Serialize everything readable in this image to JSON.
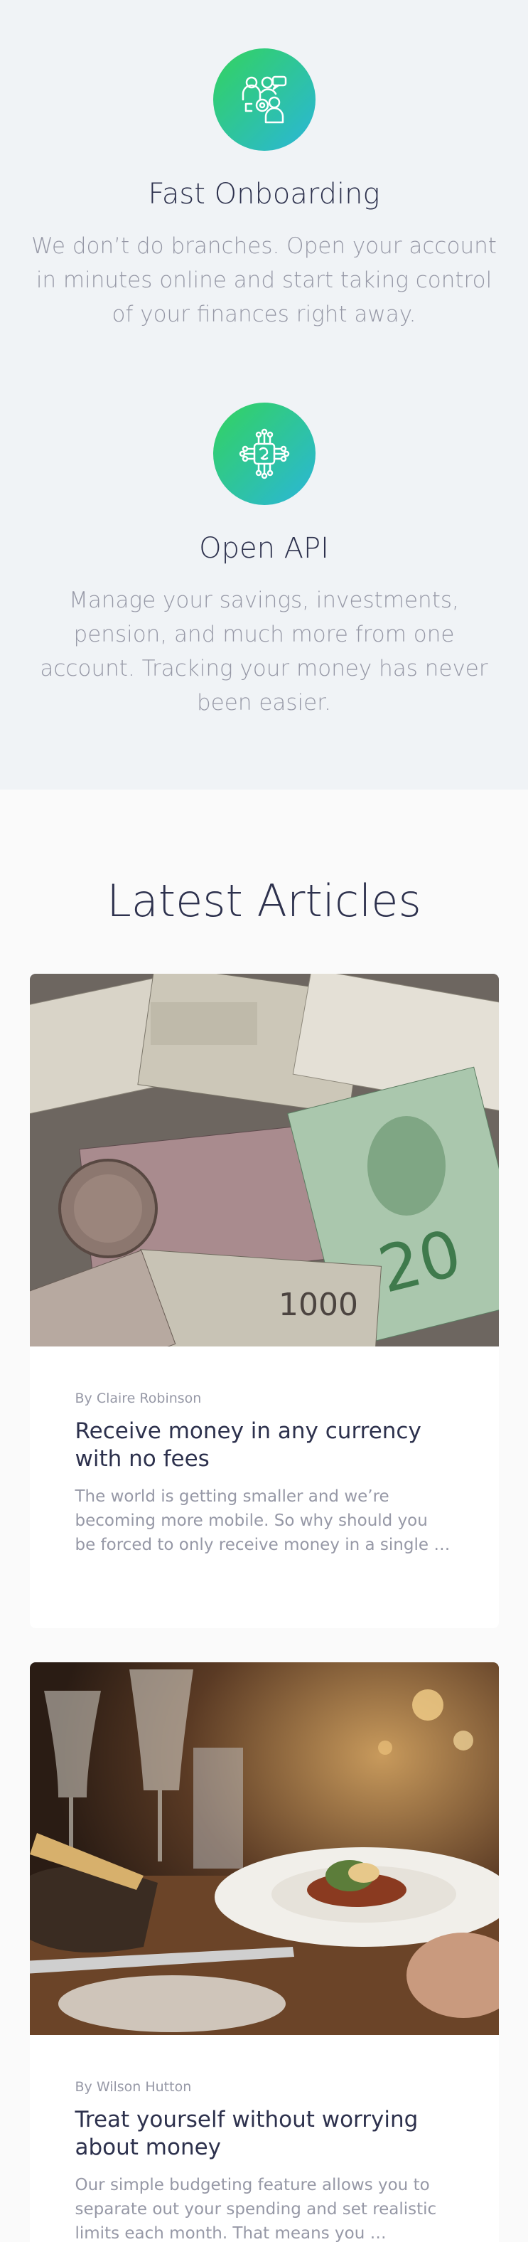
{
  "features": [
    {
      "icon": "team-onboarding-icon",
      "title": "Fast Onboarding",
      "description": "We don’t do branches. Open your account in minutes online and start taking control of your finances right away."
    },
    {
      "icon": "api-chip-icon",
      "title": "Open API",
      "description": "Manage your savings, investments, pension, and much more from one account. Tracking your money has never been easier."
    }
  ],
  "articles": {
    "heading": "Latest Articles",
    "items": [
      {
        "image": "currency-banknotes-photo",
        "author": "By Claire Robinson",
        "title": "Receive money in any currency with no fees",
        "excerpt": "The world is getting smaller and we’re becoming more mobile. So why should you be forced to only receive money in a single …"
      },
      {
        "image": "restaurant-dinner-photo",
        "author": "By Wilson Hutton",
        "title": "Treat yourself without worrying about money",
        "excerpt": "Our simple budgeting feature allows you to separate out your spending and set realistic limits each month. That means you …"
      }
    ]
  },
  "colors": {
    "gradient_start": "#33d35e",
    "gradient_end": "#2ab6d9",
    "dark_blue": "#2d314d",
    "grayish_blue": "#9698a6",
    "light_bg": "#f0f3f6"
  }
}
